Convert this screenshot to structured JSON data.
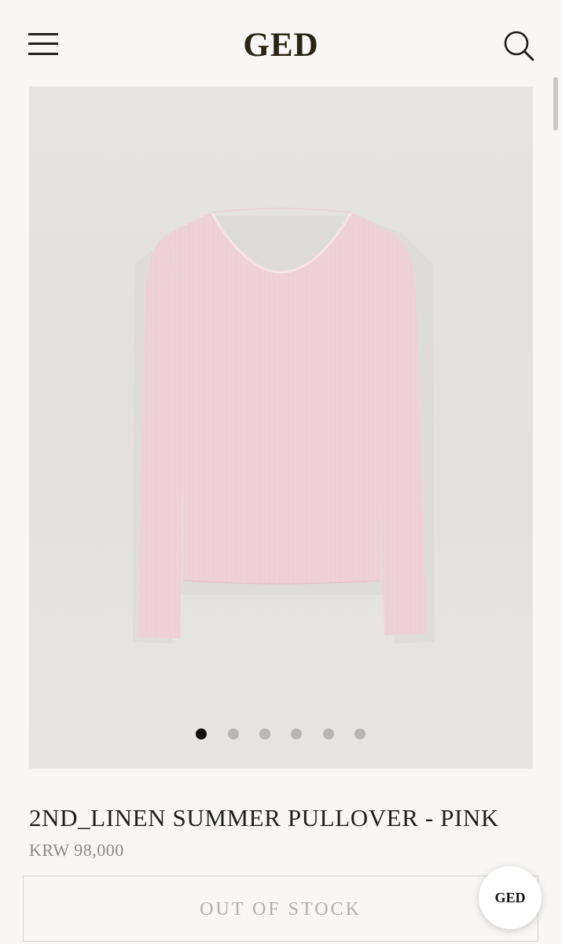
{
  "header": {
    "logo": "GED",
    "menu_icon": "hamburger-menu-icon",
    "search_icon": "search-icon"
  },
  "product": {
    "image_alt": "pink-ribbed-long-sleeve-pullover",
    "garment_color": "#f1d6dc",
    "carousel": {
      "total": 6,
      "active_index": 0
    },
    "title": "2ND_LINEN SUMMER PULLOVER - PINK",
    "price": "KRW 98,000",
    "status_button": "OUT OF STOCK"
  },
  "chat": {
    "label": "GED"
  }
}
